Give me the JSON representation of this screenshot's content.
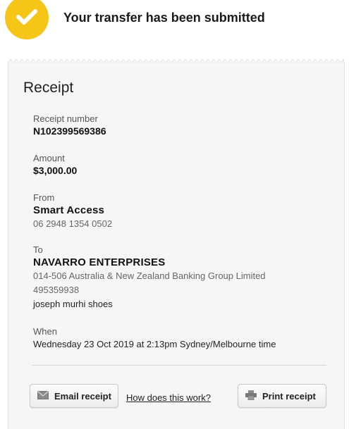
{
  "banner": {
    "title": "Your transfer has been submitted",
    "icon": "checkmark-icon",
    "accent_color": "#f5c518"
  },
  "receipt": {
    "heading": "Receipt",
    "receipt_number_label": "Receipt number",
    "receipt_number": "N102399569386",
    "amount_label": "Amount",
    "amount": "$3,000.00",
    "from_label": "From",
    "from_account_name": "Smart Access",
    "from_account_number": "06 2948 1354 0502",
    "to_label": "To",
    "to_name": "NAVARRO ENTERPRISES",
    "to_bank": "014-506 Australia & New Zealand Banking Group Limited",
    "to_account_number": "495359938",
    "to_reference": "joseph murhi shoes",
    "when_label": "When",
    "when_value": "Wednesday 23 Oct 2019 at 2:13pm Sydney/Melbourne time"
  },
  "actions": {
    "email_label": "Email receipt",
    "email_icon": "envelope-icon",
    "help_link": "How does this work?",
    "print_label": "Print receipt",
    "print_icon": "printer-icon"
  }
}
